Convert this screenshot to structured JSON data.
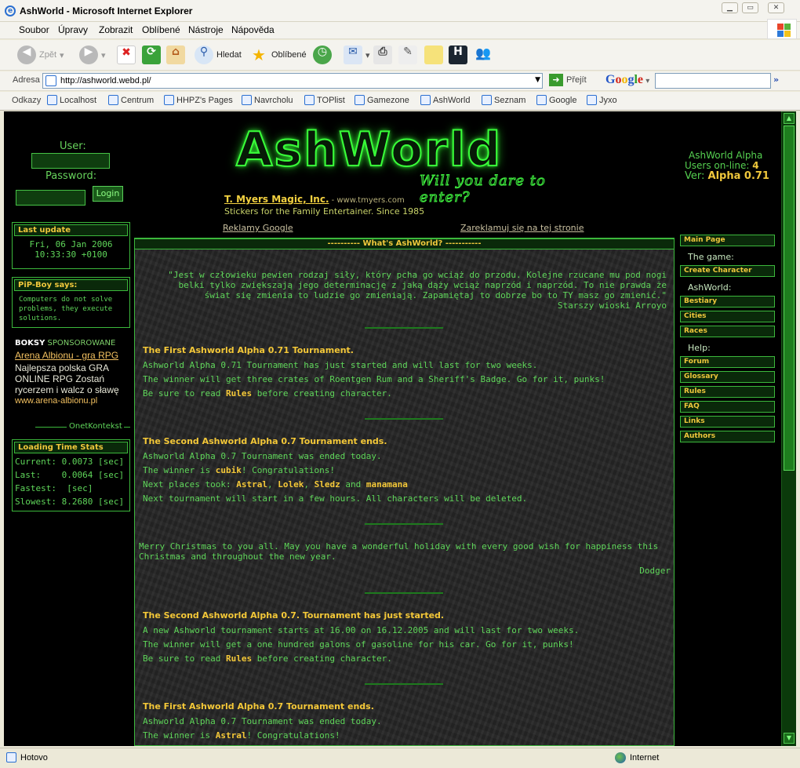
{
  "window": {
    "title": "AshWorld - Microsoft Internet Explorer"
  },
  "menu": [
    "Soubor",
    "Úpravy",
    "Zobrazit",
    "Oblíbené",
    "Nástroje",
    "Nápověda"
  ],
  "toolbar": {
    "back": "Zpět",
    "search": "Hledat",
    "favorites": "Oblíbené"
  },
  "address": {
    "label": "Adresa",
    "url": "http://ashworld.webd.pl/",
    "go": "Přejít",
    "google": "Google"
  },
  "links": {
    "label": "Odkazy",
    "items": [
      "Localhost",
      "Centrum",
      "HHPZ's Pages",
      "Navrcholu",
      "TOPlist",
      "Gamezone",
      "AshWorld",
      "Seznam",
      "Google",
      "Jyxo"
    ]
  },
  "status": {
    "left": "Hotovo",
    "zone": "Internet"
  },
  "login": {
    "user_label": "User:",
    "password_label": "Password:",
    "button": "Login"
  },
  "logo": {
    "title": "AshWorld",
    "subtitle": "Will you dare to enter?"
  },
  "ad": {
    "title": "T. Myers Magic, Inc.",
    "url": "- www.tmyers.com",
    "tagline": "Stickers for the Family Entertainer. Since 1985"
  },
  "info": {
    "line1": "AshWorld Alpha",
    "users_label": "Users on-line:",
    "users": "4",
    "ver_label": "Ver:",
    "ver": "Alpha 0.71"
  },
  "ads_links": {
    "left": "Reklamy Google",
    "right": "Zareklamuj się na tej stronie"
  },
  "last_update": {
    "header": "Last update",
    "date": "Fri, 06 Jan 2006",
    "time": "10:33:30 +0100"
  },
  "pipboy": {
    "header": "PiP-Boy says:",
    "text": "Computers do not solve problems, they execute solutions."
  },
  "boksy": {
    "bold": "BOKSY",
    "rest": "SPONSOROWANE",
    "link": "Arena Albionu - gra RPG",
    "text": "Najlepsza polska GRA ONLINE RPG Zostań rycerzem i walcz o sławę",
    "url": "www.arena-albionu.pl",
    "onet": "OnetKontekst"
  },
  "loading": {
    "header": "Loading Time Stats",
    "rows": [
      "Current: 0.0073 [sec]",
      "Last:    0.0064 [sec]",
      "Fastest:  [sec]",
      "Slowest: 8.2680 [sec]"
    ]
  },
  "main": {
    "header": "---------- What's AshWorld? -----------",
    "quote": "\"Jest w człowieku pewien rodzaj siły, który pcha go wciąż do przodu. Kolejne rzucane mu pod nogi belki tylko zwiększają jego determinację z jaką dąży wciąż naprzód i naprzód. To nie prawda że świat się zmienia to ludzie go zmieniają. Zapamiętaj to dobrze bo to TY masz go zmienić.\"",
    "quote_author": "Starszy wioski Arroyo",
    "news1": {
      "title": "The First Ashworld Alpha 0.71 Tournament.",
      "l1": "Ashworld Alpha 0.71 Tournament has just started and will last for two weeks.",
      "l2": "The winner will get three crates of Roentgen Rum and a Sheriff's Badge. Go for it, punks!",
      "l3a": "Be sure to read ",
      "l3b": "Rules",
      "l3c": " before creating character."
    },
    "news2": {
      "title": "The Second Ashworld Alpha 0.7 Tournament ends.",
      "l1": "Ashworld Alpha 0.7 Tournament was ended today.",
      "l2a": "The winner is ",
      "l2b": "cubik",
      "l2c": "! Congratulations!",
      "l3a": "Next places took: ",
      "p1": "Astral",
      "p2": "Lolek",
      "p3": "Sledz",
      "and": " and ",
      "p4": "manamana",
      "l4": "Next tournament will start in a few hours. All characters will be deleted."
    },
    "xmas": {
      "text": "Merry Christmas to you all. May you have a wonderful holiday with every good wish for happiness this Christmas and throughout the new year.",
      "sign": "Dodger"
    },
    "news3": {
      "title": "The Second Ashworld Alpha 0.7. Tournament has just started.",
      "l1": "A new Ashworld tournament starts at 16.00 on 16.12.2005 and will last for two weeks.",
      "l2": "The winner will get a one hundred galons of gasoline for his car. Go for it, punks!",
      "l3a": "Be sure to read ",
      "l3b": "Rules",
      "l3c": " before creating character."
    },
    "news4": {
      "title": "The First Ashworld Alpha 0.7 Tournament ends.",
      "l1": "Ashworld Alpha 0.7 Tournament was ended today.",
      "l2a": "The winner is ",
      "l2b": "Astral",
      "l2c": "! Congratulations!"
    }
  },
  "nav": {
    "main_page": "Main Page",
    "the_game": "The game:",
    "create": "Create Character",
    "ashworld": "AshWorld:",
    "bestiary": "Bestiary",
    "cities": "Cities",
    "races": "Races",
    "help": "Help:",
    "forum": "Forum",
    "glossary": "Glossary",
    "rules": "Rules",
    "faq": "FAQ",
    "links": "Links",
    "authors": "Authors"
  }
}
